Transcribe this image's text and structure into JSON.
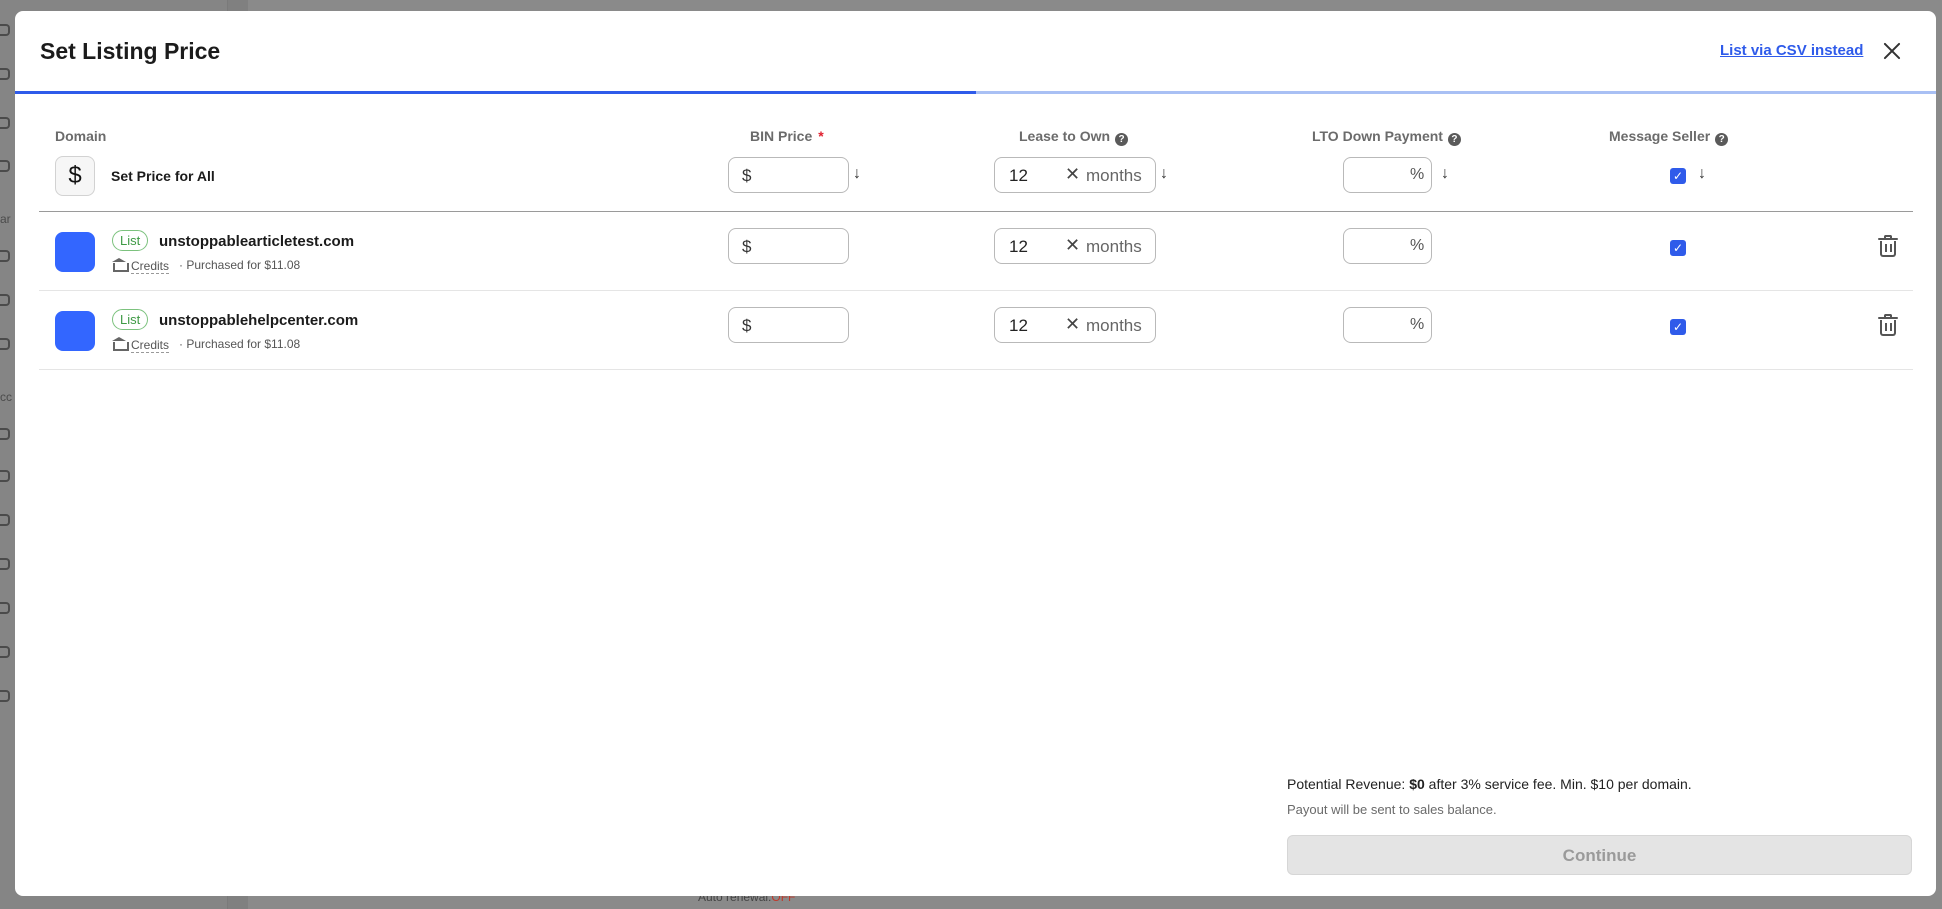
{
  "background": {
    "rail_text": [
      "ar",
      "cc"
    ],
    "auto_renewal_label": "Auto renewal:",
    "auto_renewal_value": "OFF"
  },
  "modal": {
    "title": "Set Listing Price",
    "csv_link": "List via CSV instead",
    "progress_fraction": 0.5,
    "columns": {
      "domain": "Domain",
      "bin_price": "BIN Price",
      "bin_required_mark": "*",
      "lease_to_own": "Lease to Own",
      "lto_down_payment": "LTO Down Payment",
      "message_seller": "Message Seller"
    },
    "set_all": {
      "icon": "dollar-icon",
      "icon_glyph": "$",
      "label": "Set Price for All",
      "currency": "$",
      "price_value": "",
      "lto_value": "12",
      "lto_unit": "months",
      "down_payment_value": "",
      "percent_sign": "%",
      "message_seller_checked": true
    },
    "rows": [
      {
        "badge": "List",
        "domain": "unstoppablearticletest.com",
        "payment_method": "Credits",
        "purchased": "· Purchased for $11.08",
        "currency": "$",
        "price_value": "",
        "lto_value": "12",
        "lto_unit": "months",
        "down_payment_value": "",
        "percent_sign": "%",
        "message_seller_checked": true
      },
      {
        "badge": "List",
        "domain": "unstoppablehelpcenter.com",
        "payment_method": "Credits",
        "purchased": "· Purchased for $11.08",
        "currency": "$",
        "price_value": "",
        "lto_value": "12",
        "lto_unit": "months",
        "down_payment_value": "",
        "percent_sign": "%",
        "message_seller_checked": true
      }
    ],
    "footer": {
      "revenue_label": "Potential Revenue:",
      "revenue_value": "$0",
      "revenue_suffix": "after 3% service fee. Min. $10 per domain.",
      "payout_note": "Payout will be sent to sales balance.",
      "continue_label": "Continue"
    },
    "colors": {
      "accent": "#2f5bea",
      "domain_tile": "#3366ff",
      "list_badge": "#3f9a45"
    }
  }
}
